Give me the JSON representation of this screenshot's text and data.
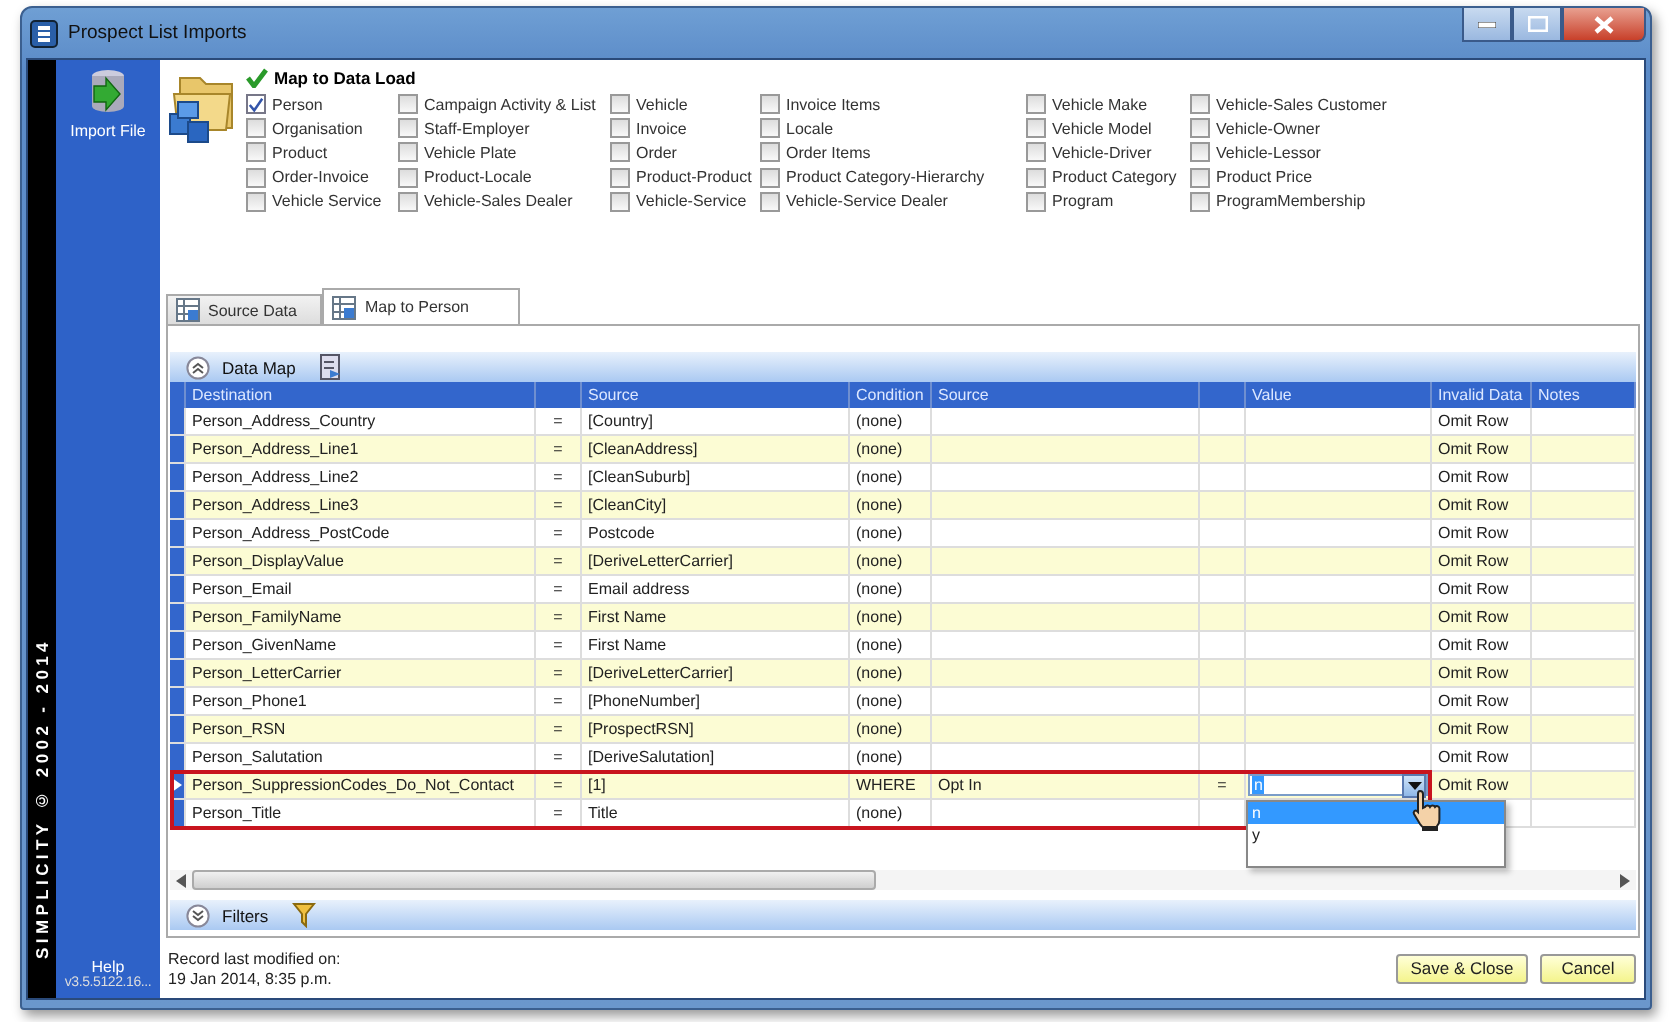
{
  "window": {
    "title": "Prospect List Imports"
  },
  "sidebar": {
    "import_button": "Import File",
    "banner": "SIMPLICITY © 2002 - 2014",
    "help": "Help",
    "version": "v3.5.5122.16..."
  },
  "map_to_data_load": {
    "title": "Map to Data Load",
    "columns": [
      [
        {
          "label": "Person",
          "checked": true
        },
        {
          "label": "Organisation",
          "checked": false
        },
        {
          "label": "Product",
          "checked": false
        },
        {
          "label": "Order-Invoice",
          "checked": false
        },
        {
          "label": "Vehicle Service",
          "checked": false
        }
      ],
      [
        {
          "label": "Campaign Activity & List",
          "checked": false
        },
        {
          "label": "Staff-Employer",
          "checked": false
        },
        {
          "label": "Vehicle Plate",
          "checked": false
        },
        {
          "label": "Product-Locale",
          "checked": false
        },
        {
          "label": "Vehicle-Sales Dealer",
          "checked": false
        }
      ],
      [
        {
          "label": "Vehicle",
          "checked": false
        },
        {
          "label": "Invoice",
          "checked": false
        },
        {
          "label": "Order",
          "checked": false
        },
        {
          "label": "Product-Product",
          "checked": false
        },
        {
          "label": "Vehicle-Service",
          "checked": false
        }
      ],
      [
        {
          "label": "Invoice Items",
          "checked": false
        },
        {
          "label": "Locale",
          "checked": false
        },
        {
          "label": "Order Items",
          "checked": false
        },
        {
          "label": "Product Category-Hierarchy",
          "checked": false
        },
        {
          "label": "Vehicle-Service Dealer",
          "checked": false
        }
      ],
      [
        {
          "label": "Vehicle Make",
          "checked": false
        },
        {
          "label": "Vehicle Model",
          "checked": false
        },
        {
          "label": "Vehicle-Driver",
          "checked": false
        },
        {
          "label": "Product Category",
          "checked": false
        },
        {
          "label": "Program",
          "checked": false
        }
      ],
      [
        {
          "label": "Vehicle-Sales Customer",
          "checked": false
        },
        {
          "label": "Vehicle-Owner",
          "checked": false
        },
        {
          "label": "Vehicle-Lessor",
          "checked": false
        },
        {
          "label": "Product Price",
          "checked": false
        },
        {
          "label": "ProgramMembership",
          "checked": false
        }
      ]
    ]
  },
  "tabs": [
    {
      "label": "Source Data",
      "selected": false
    },
    {
      "label": "Map to Person",
      "selected": true
    }
  ],
  "data_map": {
    "title": "Data Map",
    "columns": {
      "destination": "Destination",
      "source": "Source",
      "condition": "Condition",
      "condition_source": "Source",
      "value": "Value",
      "invalid_data": "Invalid Data",
      "notes": "Notes"
    },
    "rows": [
      {
        "destination": "Person_Address_Country",
        "operator": "=",
        "source": "[Country]",
        "condition": "(none)",
        "invalid_data": "Omit Row",
        "selected": false
      },
      {
        "destination": "Person_Address_Line1",
        "operator": "=",
        "source": "[CleanAddress]",
        "condition": "(none)",
        "invalid_data": "Omit Row",
        "selected": false
      },
      {
        "destination": "Person_Address_Line2",
        "operator": "=",
        "source": "[CleanSuburb]",
        "condition": "(none)",
        "invalid_data": "Omit Row",
        "selected": false
      },
      {
        "destination": "Person_Address_Line3",
        "operator": "=",
        "source": "[CleanCity]",
        "condition": "(none)",
        "invalid_data": "Omit Row",
        "selected": false
      },
      {
        "destination": "Person_Address_PostCode",
        "operator": "=",
        "source": "Postcode",
        "condition": "(none)",
        "invalid_data": "Omit Row",
        "selected": false
      },
      {
        "destination": "Person_DisplayValue",
        "operator": "=",
        "source": "[DeriveLetterCarrier]",
        "condition": "(none)",
        "invalid_data": "Omit Row",
        "selected": false
      },
      {
        "destination": "Person_Email",
        "operator": "=",
        "source": "Email address",
        "condition": "(none)",
        "invalid_data": "Omit Row",
        "selected": false
      },
      {
        "destination": "Person_FamilyName",
        "operator": "=",
        "source": "First Name",
        "condition": "(none)",
        "invalid_data": "Omit Row",
        "selected": false
      },
      {
        "destination": "Person_GivenName",
        "operator": "=",
        "source": "First Name",
        "condition": "(none)",
        "invalid_data": "Omit Row",
        "selected": false
      },
      {
        "destination": "Person_LetterCarrier",
        "operator": "=",
        "source": "[DeriveLetterCarrier]",
        "condition": "(none)",
        "invalid_data": "Omit Row",
        "selected": false
      },
      {
        "destination": "Person_Phone1",
        "operator": "=",
        "source": "[PhoneNumber]",
        "condition": "(none)",
        "invalid_data": "Omit Row",
        "selected": false
      },
      {
        "destination": "Person_RSN",
        "operator": "=",
        "source": "[ProspectRSN]",
        "condition": "(none)",
        "invalid_data": "Omit Row",
        "selected": false
      },
      {
        "destination": "Person_Salutation",
        "operator": "=",
        "source": "[DeriveSalutation]",
        "condition": "(none)",
        "invalid_data": "Omit Row",
        "selected": false
      },
      {
        "destination": "Person_SuppressionCodes_Do_Not_Contact",
        "operator": "=",
        "source": "[1]",
        "condition": "WHERE",
        "condition_source": "Opt In",
        "comparator": "=",
        "value": "n",
        "invalid_data": "Omit Row",
        "selected": true
      },
      {
        "destination": "Person_Title",
        "operator": "=",
        "source": "Title",
        "condition": "(none)",
        "selected": false
      }
    ],
    "dropdown_options": [
      {
        "label": "n",
        "selected": true
      },
      {
        "label": "y",
        "selected": false
      }
    ]
  },
  "filters": {
    "title": "Filters"
  },
  "footer": {
    "record_label": "Record last modified on:",
    "record_date": "19 Jan 2014, 8:35 p.m.",
    "buttons": [
      "Save & Close",
      "Cancel"
    ]
  }
}
